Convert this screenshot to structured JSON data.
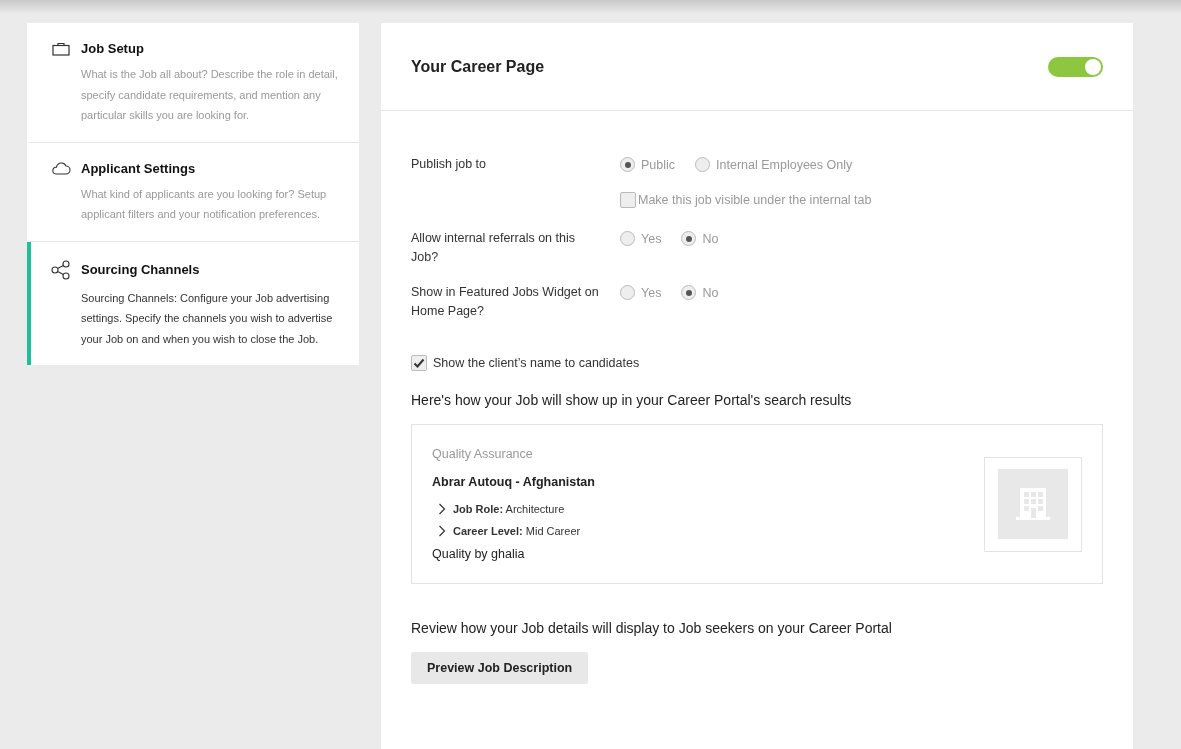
{
  "sidebar": {
    "items": [
      {
        "kind": "briefcase",
        "title": "Job Setup",
        "description": "What is the Job all about? Describe the role in detail, specify candidate requirements, and mention any particular skills you are looking for.",
        "selected": false
      },
      {
        "kind": "cloud",
        "title": "Applicant Settings",
        "description": "What kind of applicants are you looking for? Setup applicant filters and your notification preferences.",
        "selected": false
      },
      {
        "kind": "share",
        "title": "Sourcing Channels",
        "description": "Sourcing Channels: Configure your Job advertising settings. Specify the channels you wish to advertise your Job on and when you wish to close the Job.",
        "selected": true
      }
    ]
  },
  "career_page": {
    "title": "Your Career Page",
    "enabled": true,
    "rows": [
      {
        "kind": "radio",
        "label": "Publish job to",
        "options": [
          {
            "label": "Public",
            "selected": true
          },
          {
            "label": "Internal Employees Only",
            "selected": false
          }
        ]
      },
      {
        "kind": "checkbox",
        "label": "Make this job visible under the internal tab",
        "checked": false
      },
      {
        "kind": "radio",
        "label": "Allow internal referrals on this Job?",
        "options": [
          {
            "label": "Yes",
            "selected": false
          },
          {
            "label": "No",
            "selected": true
          }
        ]
      },
      {
        "kind": "radio",
        "label": "Show in Featured Jobs Widget on Home Page?",
        "options": [
          {
            "label": "Yes",
            "selected": false
          },
          {
            "label": "No",
            "selected": true
          }
        ]
      }
    ],
    "show_client_name": {
      "label": "Show the client’s name to candidates",
      "checked": true
    },
    "preview_heading": "Here's how your Job will show up in your Career Portal's search results",
    "preview": {
      "category": "Quality Assurance",
      "title": "Abrar Autouq - Afghanistan",
      "details": [
        {
          "name": "Job Role:",
          "value": "Architecture"
        },
        {
          "name": "Career Level:",
          "value": "Mid Career"
        }
      ],
      "company": "Quality by ghalia"
    },
    "review_text": "Review how your Job details will display to Job seekers on your Career Portal",
    "preview_button": "Preview Job Description"
  }
}
